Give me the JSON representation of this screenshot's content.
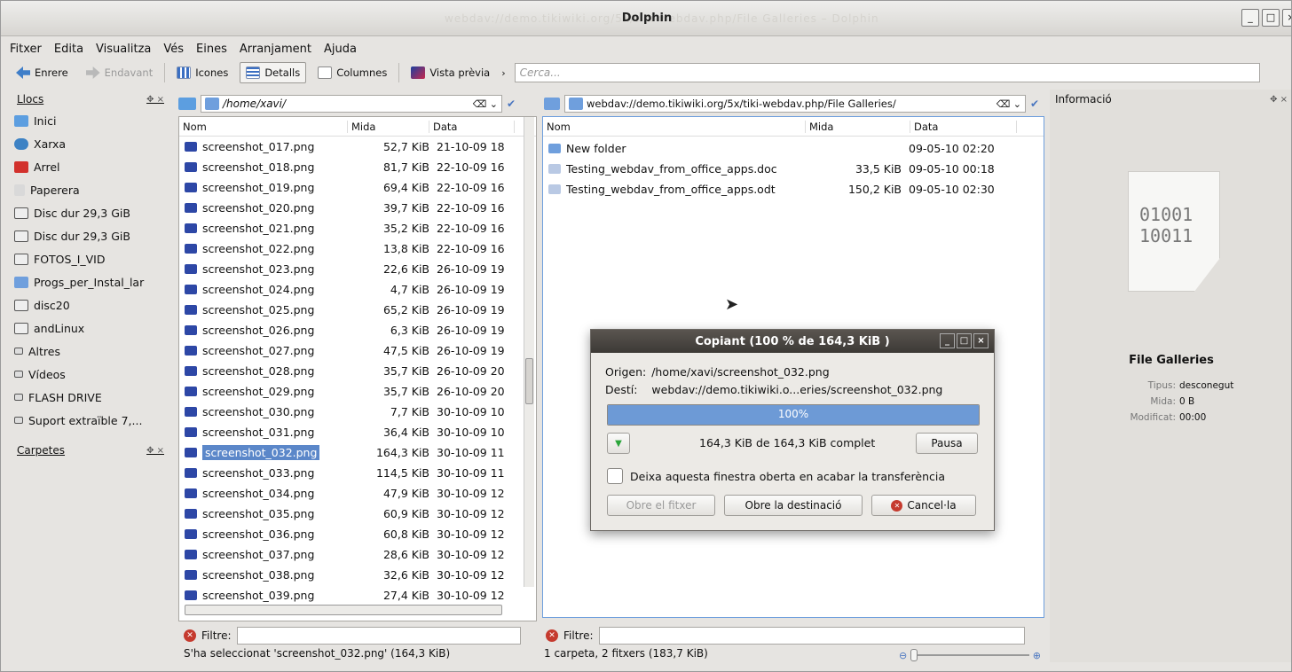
{
  "window": {
    "title": "Dolphin",
    "ghost_title": "webdav://demo.tikiwiki.org/5x/tiki-webdav.php/File Galleries – Dolphin"
  },
  "menu": [
    "Fitxer",
    "Edita",
    "Visualitza",
    "Vés",
    "Eines",
    "Arranjament",
    "Ajuda"
  ],
  "toolbar": {
    "back": "Enrere",
    "forward": "Endavant",
    "icons": "Icones",
    "details": "Detalls",
    "columns": "Columnes",
    "preview": "Vista prèvia",
    "search_placeholder": "Cerca..."
  },
  "places": {
    "title": "Llocs",
    "items": [
      "Inici",
      "Xarxa",
      "Arrel",
      "Paperera",
      "Disc dur 29,3 GiB",
      "Disc dur 29,3 GiB",
      "FOTOS_I_VID",
      "Progs_per_Instal_lar",
      "disc20",
      "andLinux",
      "Altres",
      "Vídeos",
      "FLASH DRIVE",
      "Suport extraïble 7,..."
    ]
  },
  "folders": {
    "title": "Carpetes"
  },
  "left_pane": {
    "path": "/home/xavi/",
    "columns": {
      "name": "Nom",
      "size": "Mida",
      "date": "Data"
    },
    "rows": [
      {
        "name": "screenshot_017.png",
        "size": "52,7 KiB",
        "date": "21-10-09 18"
      },
      {
        "name": "screenshot_018.png",
        "size": "81,7 KiB",
        "date": "22-10-09 16"
      },
      {
        "name": "screenshot_019.png",
        "size": "69,4 KiB",
        "date": "22-10-09 16"
      },
      {
        "name": "screenshot_020.png",
        "size": "39,7 KiB",
        "date": "22-10-09 16"
      },
      {
        "name": "screenshot_021.png",
        "size": "35,2 KiB",
        "date": "22-10-09 16"
      },
      {
        "name": "screenshot_022.png",
        "size": "13,8 KiB",
        "date": "22-10-09 16"
      },
      {
        "name": "screenshot_023.png",
        "size": "22,6 KiB",
        "date": "26-10-09 19"
      },
      {
        "name": "screenshot_024.png",
        "size": "4,7 KiB",
        "date": "26-10-09 19"
      },
      {
        "name": "screenshot_025.png",
        "size": "65,2 KiB",
        "date": "26-10-09 19"
      },
      {
        "name": "screenshot_026.png",
        "size": "6,3 KiB",
        "date": "26-10-09 19"
      },
      {
        "name": "screenshot_027.png",
        "size": "47,5 KiB",
        "date": "26-10-09 19"
      },
      {
        "name": "screenshot_028.png",
        "size": "35,7 KiB",
        "date": "26-10-09 20"
      },
      {
        "name": "screenshot_029.png",
        "size": "35,7 KiB",
        "date": "26-10-09 20"
      },
      {
        "name": "screenshot_030.png",
        "size": "7,7 KiB",
        "date": "30-10-09 10"
      },
      {
        "name": "screenshot_031.png",
        "size": "36,4 KiB",
        "date": "30-10-09 10"
      },
      {
        "name": "screenshot_032.png",
        "size": "164,3 KiB",
        "date": "30-10-09 11"
      },
      {
        "name": "screenshot_033.png",
        "size": "114,5 KiB",
        "date": "30-10-09 11"
      },
      {
        "name": "screenshot_034.png",
        "size": "47,9 KiB",
        "date": "30-10-09 12"
      },
      {
        "name": "screenshot_035.png",
        "size": "60,9 KiB",
        "date": "30-10-09 12"
      },
      {
        "name": "screenshot_036.png",
        "size": "60,8 KiB",
        "date": "30-10-09 12"
      },
      {
        "name": "screenshot_037.png",
        "size": "28,6 KiB",
        "date": "30-10-09 12"
      },
      {
        "name": "screenshot_038.png",
        "size": "32,6 KiB",
        "date": "30-10-09 12"
      },
      {
        "name": "screenshot_039.png",
        "size": "27,4 KiB",
        "date": "30-10-09 12"
      }
    ],
    "selected": 15,
    "filter_label": "Filtre:",
    "status": "S'ha seleccionat 'screenshot_032.png' (164,3 KiB)"
  },
  "right_pane": {
    "path": "webdav://demo.tikiwiki.org/5x/tiki-webdav.php/File Galleries/",
    "columns": {
      "name": "Nom",
      "size": "Mida",
      "date": "Data"
    },
    "rows": [
      {
        "name": "New folder",
        "size": "",
        "date": "09-05-10 02:20"
      },
      {
        "name": "Testing_webdav_from_office_apps.doc",
        "size": "33,5 KiB",
        "date": "09-05-10 00:18"
      },
      {
        "name": "Testing_webdav_from_office_apps.odt",
        "size": "150,2 KiB",
        "date": "09-05-10 02:30"
      }
    ],
    "filter_label": "Filtre:",
    "status": "1 carpeta, 2 fitxers (183,7 KiB)"
  },
  "info": {
    "title": "Informació",
    "binary_top": "01001",
    "binary_bottom": "10011",
    "name": "File Galleries",
    "type_label": "Tipus:",
    "type": "desconegut",
    "size_label": "Mida:",
    "size": "0 B",
    "modified_label": "Modificat:",
    "modified": "00:00"
  },
  "dialog": {
    "title": "Copiant (100 % de 164,3 KiB )",
    "source_label": "Origen:",
    "source": "/home/xavi/screenshot_032.png",
    "dest_label": "Destí:",
    "dest": "webdav://demo.tikiwiki.o...eries/screenshot_032.png",
    "progress_text": "100%",
    "progress": 1.0,
    "transfer": "164,3 KiB de 164,3 KiB complet",
    "pause": "Pausa",
    "keep_open": "Deixa aquesta finestra oberta en acabar la transferència",
    "open_file": "Obre el fitxer",
    "open_dest": "Obre la destinació",
    "cancel": "Cancel·la"
  },
  "colors": {
    "selection": "#5b87c9",
    "progress": "#6d9ad6",
    "png_icon": "#2d47a6",
    "folder": "#6f9fdd"
  }
}
